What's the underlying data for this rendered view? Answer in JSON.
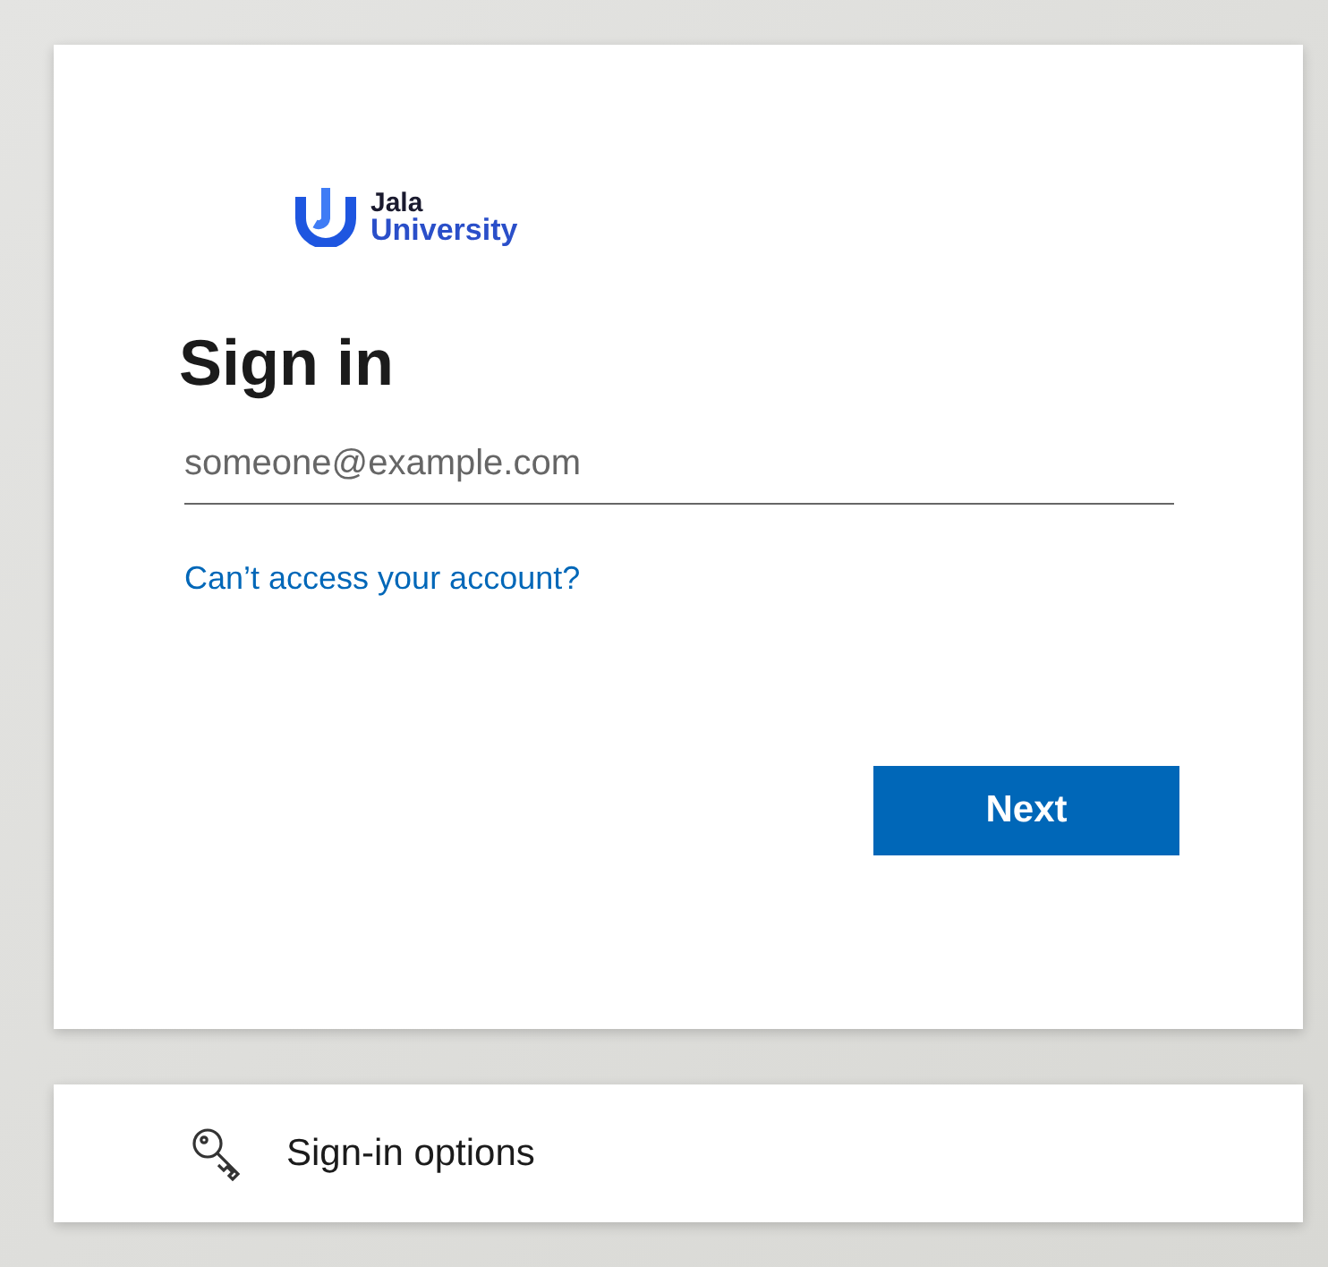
{
  "logo": {
    "line_1": "Jala",
    "line_2": "University"
  },
  "title": "Sign in",
  "email_field": {
    "placeholder": "someone@example.com"
  },
  "help_link": "Can’t access your account?",
  "next_button": "Next",
  "options": {
    "label": "Sign-in options"
  }
}
